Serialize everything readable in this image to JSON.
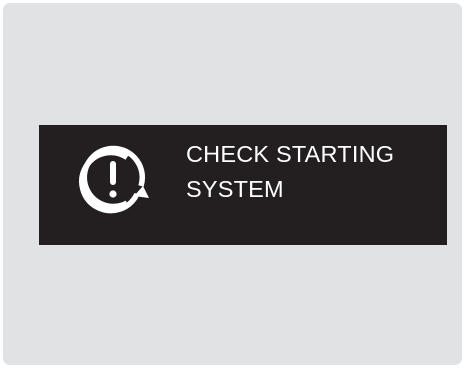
{
  "warning": {
    "icon": "engine-start-warning-icon",
    "line1": "CHECK STARTING",
    "line2": "SYSTEM"
  },
  "colors": {
    "frame_background": "#e0e2e3",
    "panel_background": "#231f20",
    "text": "#ffffff"
  }
}
